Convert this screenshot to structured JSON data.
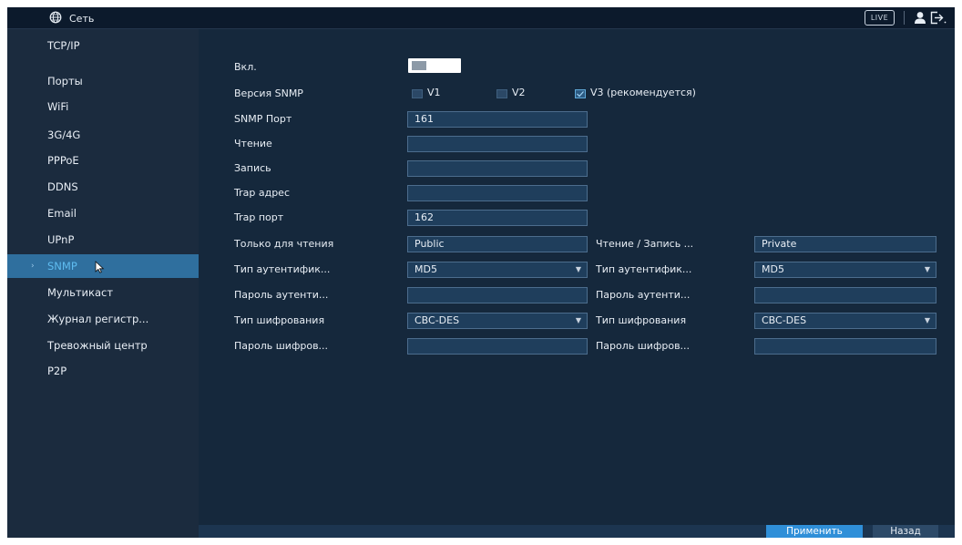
{
  "topbar": {
    "title": "Сеть",
    "icon": "globe-icon",
    "live_label": "LIVE",
    "user_icon": "user-icon",
    "logout_icon": "logout-icon"
  },
  "sidebar": {
    "items": [
      {
        "label": "TCP/IP"
      },
      {
        "label": "Порты"
      },
      {
        "label": "WiFi"
      },
      {
        "label": "3G/4G"
      },
      {
        "label": "PPPoE"
      },
      {
        "label": "DDNS"
      },
      {
        "label": "Email"
      },
      {
        "label": "UPnP"
      },
      {
        "label": "SNMP",
        "active": true
      },
      {
        "label": "Мультикаст"
      },
      {
        "label": "Журнал регистр..."
      },
      {
        "label": "Тревожный центр"
      },
      {
        "label": "P2P"
      }
    ],
    "active_marker": "›"
  },
  "form": {
    "enable": {
      "label": "Вкл.",
      "on": false
    },
    "snmp_version": {
      "label": "Версия SNMP",
      "options": [
        {
          "label": "V1",
          "checked": false
        },
        {
          "label": "V2",
          "checked": false
        },
        {
          "label": "V3 (рекомендуется)",
          "checked": true
        }
      ]
    },
    "snmp_port": {
      "label": "SNMP Порт",
      "value": "161"
    },
    "read": {
      "label": "Чтение",
      "value": ""
    },
    "write": {
      "label": "Запись",
      "value": ""
    },
    "trap_address": {
      "label": "Trap адрес",
      "value": ""
    },
    "trap_port": {
      "label": "Trap порт",
      "value": "162"
    },
    "read_only": {
      "label": "Только для чтения",
      "value": "Public"
    },
    "read_write": {
      "label": "Чтение / Запись ...",
      "value": "Private"
    },
    "auth_type_left": {
      "label": "Тип аутентифик...",
      "value": "MD5"
    },
    "auth_type_right": {
      "label": "Тип аутентифик...",
      "value": "MD5"
    },
    "auth_pass_left": {
      "label": "Пароль аутенти...",
      "value": ""
    },
    "auth_pass_right": {
      "label": "Пароль аутенти...",
      "value": ""
    },
    "enc_type_left": {
      "label": "Тип шифрования",
      "value": "CBC-DES"
    },
    "enc_type_right": {
      "label": "Тип шифрования",
      "value": "CBC-DES"
    },
    "enc_pass_left": {
      "label": "Пароль шифров...",
      "value": ""
    },
    "enc_pass_right": {
      "label": "Пароль шифров...",
      "value": ""
    }
  },
  "buttons": {
    "apply": "Применить",
    "back": "Назад"
  },
  "colors": {
    "background": "#1b2b3e",
    "content": "#15283c",
    "accent": "#2f8fd8",
    "active_text": "#5fbcf0"
  }
}
